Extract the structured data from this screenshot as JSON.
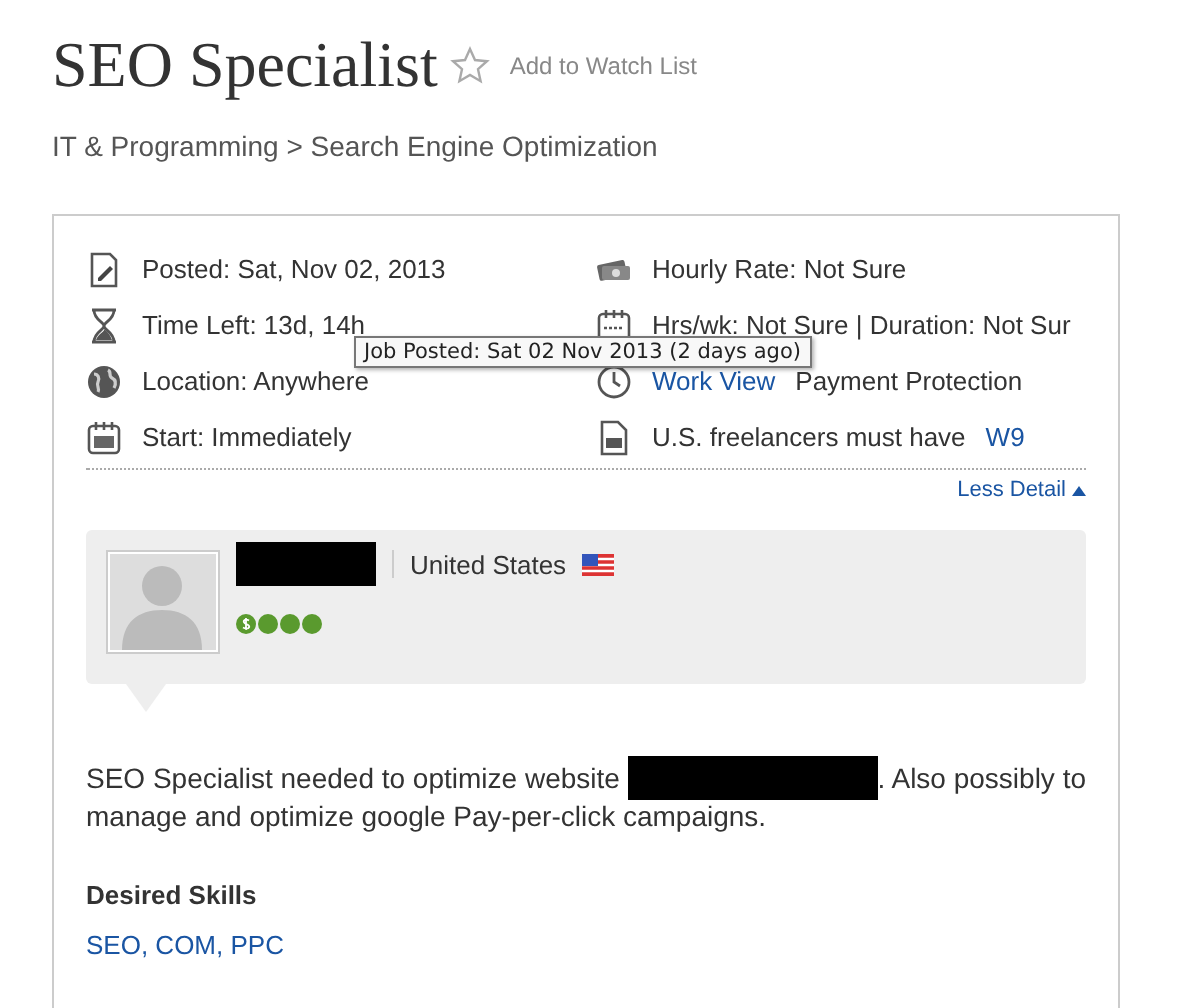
{
  "title": "SEO Specialist",
  "watch_link": "Add to Watch List",
  "breadcrumb": "IT & Programming > Search Engine Optimization",
  "details": [
    {
      "kind": "posted",
      "parts": [
        {
          "text": "Posted: Sat, Nov 02, 2013",
          "link": false
        }
      ]
    },
    {
      "kind": "rate",
      "parts": [
        {
          "text": "Hourly Rate: Not Sure",
          "link": false
        }
      ]
    },
    {
      "kind": "time",
      "parts": [
        {
          "text": "Time Left: 13d, 14h",
          "link": false
        }
      ]
    },
    {
      "kind": "calendar",
      "parts": [
        {
          "text": "Hrs/wk: Not Sure | Duration: Not Sur",
          "link": false
        }
      ]
    },
    {
      "kind": "globe",
      "parts": [
        {
          "text": "Location: Anywhere",
          "link": false
        }
      ]
    },
    {
      "kind": "clock",
      "parts": [
        {
          "text": "Work View",
          "link": true
        },
        {
          "text": "Payment Protection",
          "link": false
        }
      ]
    },
    {
      "kind": "start",
      "parts": [
        {
          "text": "Start: Immediately",
          "link": false
        }
      ]
    },
    {
      "kind": "w9",
      "parts": [
        {
          "text": "U.S. freelancers must have",
          "link": false
        },
        {
          "text": "W9",
          "link": true
        }
      ]
    }
  ],
  "tooltip": "Job Posted: Sat 02 Nov 2013 (2 days ago)",
  "less_detail": "Less Detail",
  "client": {
    "country": "United States"
  },
  "description": {
    "before": "SEO Specialist needed to optimize website",
    "after": ". Also possibly to",
    "line_2": "manage and optimize google Pay-per-click campaigns."
  },
  "skills_heading": "Desired Skills",
  "skills": "SEO, COM, PPC"
}
